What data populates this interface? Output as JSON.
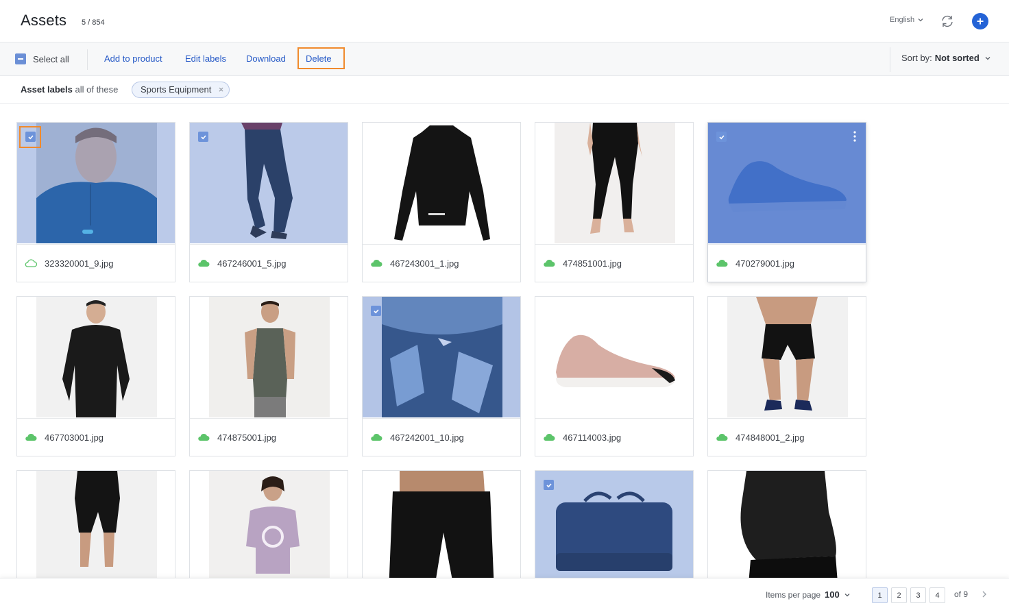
{
  "header": {
    "title": "Assets",
    "count": "5 / 854",
    "language": "English"
  },
  "toolbar": {
    "select_all": "Select all",
    "actions": [
      "Add to product",
      "Edit labels",
      "Download",
      "Delete"
    ],
    "sort_prefix": "Sort by:",
    "sort_value": "Not sorted"
  },
  "filter": {
    "label_strong": "Asset labels",
    "label_rest": "all of these",
    "chip": "Sports Equipment"
  },
  "assets": [
    {
      "file": "323320001_9.jpg",
      "selected": true
    },
    {
      "file": "467246001_5.jpg",
      "selected": true
    },
    {
      "file": "467243001_1.jpg",
      "selected": false
    },
    {
      "file": "474851001.jpg",
      "selected": false
    },
    {
      "file": "470279001.jpg",
      "selected": true
    },
    {
      "file": "467703001.jpg",
      "selected": false
    },
    {
      "file": "474875001.jpg",
      "selected": false
    },
    {
      "file": "467242001_10.jpg",
      "selected": true
    },
    {
      "file": "467114003.jpg",
      "selected": false
    },
    {
      "file": "474848001_2.jpg",
      "selected": false
    },
    {
      "file": "",
      "selected": false
    },
    {
      "file": "",
      "selected": false
    },
    {
      "file": "",
      "selected": false
    },
    {
      "file": "",
      "selected": true
    },
    {
      "file": "",
      "selected": false
    }
  ],
  "pager": {
    "items_per_page_label": "Items per page",
    "items_per_page": "100",
    "pages": [
      "1",
      "2",
      "3",
      "4"
    ],
    "current_page": "1",
    "of": "of 9"
  },
  "colors": {
    "accent": "#2463d6",
    "link": "#2458c6",
    "highlight": "#f08a2c",
    "cloud": "#5cc46a"
  }
}
